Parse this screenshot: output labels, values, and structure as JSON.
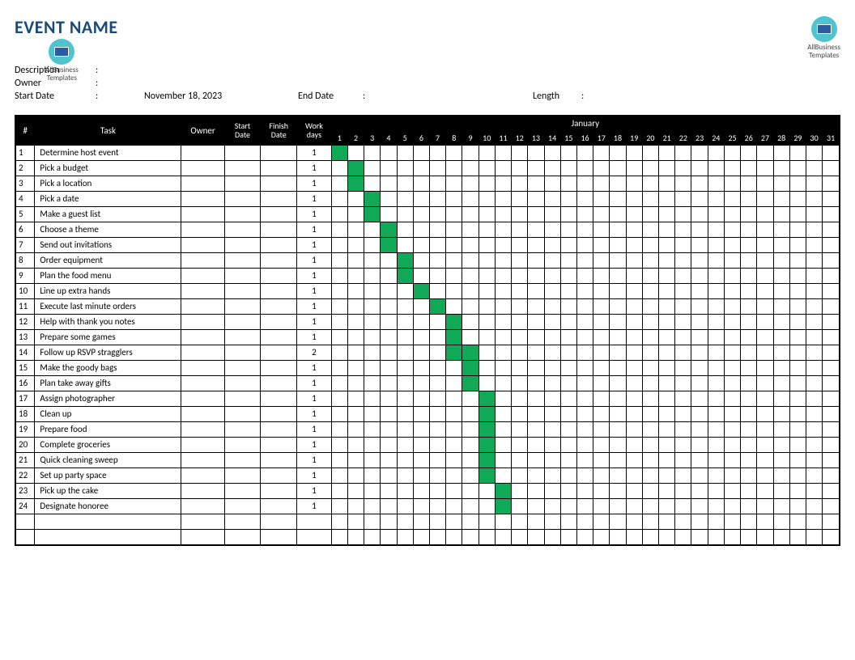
{
  "title": "EVENT NAME",
  "logo_text": "AllBusiness\nTemplates",
  "meta": {
    "description_label": "Description",
    "description_value": "",
    "owner_label": "Owner",
    "owner_value": "",
    "start_label": "Start Date",
    "start_value": "November 18, 2023",
    "end_label": "End Date",
    "end_value": "",
    "length_label": "Length",
    "length_value": ""
  },
  "columns": {
    "num": "#",
    "task": "Task",
    "owner": "Owner",
    "start": "Start Date",
    "finish": "Finish Date",
    "work": "Work days",
    "month": "January"
  },
  "days": [
    1,
    2,
    3,
    4,
    5,
    6,
    7,
    8,
    9,
    10,
    11,
    12,
    13,
    14,
    15,
    16,
    17,
    18,
    19,
    20,
    21,
    22,
    23,
    24,
    25,
    26,
    27,
    28,
    29,
    30,
    31
  ],
  "tasks": [
    {
      "num": 1,
      "name": "Determine host event",
      "owner": "",
      "start": "",
      "finish": "",
      "wd": 1,
      "bar_start": 1,
      "bar_len": 1
    },
    {
      "num": 2,
      "name": "Pick a budget",
      "owner": "",
      "start": "",
      "finish": "",
      "wd": 1,
      "bar_start": 2,
      "bar_len": 1
    },
    {
      "num": 3,
      "name": "Pick a location",
      "owner": "",
      "start": "",
      "finish": "",
      "wd": 1,
      "bar_start": 2,
      "bar_len": 1
    },
    {
      "num": 4,
      "name": "Pick a date",
      "owner": "",
      "start": "",
      "finish": "",
      "wd": 1,
      "bar_start": 3,
      "bar_len": 1
    },
    {
      "num": 5,
      "name": "Make a guest list",
      "owner": "",
      "start": "",
      "finish": "",
      "wd": 1,
      "bar_start": 3,
      "bar_len": 1
    },
    {
      "num": 6,
      "name": "Choose a theme",
      "owner": "",
      "start": "",
      "finish": "",
      "wd": 1,
      "bar_start": 4,
      "bar_len": 1
    },
    {
      "num": 7,
      "name": "Send out invitations",
      "owner": "",
      "start": "",
      "finish": "",
      "wd": 1,
      "bar_start": 4,
      "bar_len": 1
    },
    {
      "num": 8,
      "name": "Order equipment",
      "owner": "",
      "start": "",
      "finish": "",
      "wd": 1,
      "bar_start": 5,
      "bar_len": 1
    },
    {
      "num": 9,
      "name": "Plan the food menu",
      "owner": "",
      "start": "",
      "finish": "",
      "wd": 1,
      "bar_start": 5,
      "bar_len": 1
    },
    {
      "num": 10,
      "name": "Line up extra hands",
      "owner": "",
      "start": "",
      "finish": "",
      "wd": 1,
      "bar_start": 6,
      "bar_len": 1
    },
    {
      "num": 11,
      "name": "Execute last minute orders",
      "owner": "",
      "start": "",
      "finish": "",
      "wd": 1,
      "bar_start": 7,
      "bar_len": 1
    },
    {
      "num": 12,
      "name": "Help with thank you notes",
      "owner": "",
      "start": "",
      "finish": "",
      "wd": 1,
      "bar_start": 8,
      "bar_len": 1
    },
    {
      "num": 13,
      "name": "Prepare some games",
      "owner": "",
      "start": "",
      "finish": "",
      "wd": 1,
      "bar_start": 8,
      "bar_len": 1
    },
    {
      "num": 14,
      "name": "Follow up RSVP stragglers",
      "owner": "",
      "start": "",
      "finish": "",
      "wd": 2,
      "bar_start": 8,
      "bar_len": 2
    },
    {
      "num": 15,
      "name": "Make the goody bags",
      "owner": "",
      "start": "",
      "finish": "",
      "wd": 1,
      "bar_start": 9,
      "bar_len": 1
    },
    {
      "num": 16,
      "name": "Plan take away gifts",
      "owner": "",
      "start": "",
      "finish": "",
      "wd": 1,
      "bar_start": 9,
      "bar_len": 1
    },
    {
      "num": 17,
      "name": "Assign photographer",
      "owner": "",
      "start": "",
      "finish": "",
      "wd": 1,
      "bar_start": 10,
      "bar_len": 1
    },
    {
      "num": 18,
      "name": "Clean up",
      "owner": "",
      "start": "",
      "finish": "",
      "wd": 1,
      "bar_start": 10,
      "bar_len": 1
    },
    {
      "num": 19,
      "name": "Prepare food",
      "owner": "",
      "start": "",
      "finish": "",
      "wd": 1,
      "bar_start": 10,
      "bar_len": 1
    },
    {
      "num": 20,
      "name": "Complete groceries",
      "owner": "",
      "start": "",
      "finish": "",
      "wd": 1,
      "bar_start": 10,
      "bar_len": 1
    },
    {
      "num": 21,
      "name": "Quick cleaning sweep",
      "owner": "",
      "start": "",
      "finish": "",
      "wd": 1,
      "bar_start": 10,
      "bar_len": 1
    },
    {
      "num": 22,
      "name": "Set up party space",
      "owner": "",
      "start": "",
      "finish": "",
      "wd": 1,
      "bar_start": 10,
      "bar_len": 1
    },
    {
      "num": 23,
      "name": "Pick up the cake",
      "owner": "",
      "start": "",
      "finish": "",
      "wd": 1,
      "bar_start": 11,
      "bar_len": 1
    },
    {
      "num": 24,
      "name": "Designate honoree",
      "owner": "",
      "start": "",
      "finish": "",
      "wd": 1,
      "bar_start": 11,
      "bar_len": 1
    }
  ],
  "empty_rows": 2,
  "colors": {
    "bar": "#0fa958",
    "header_bg": "#000000",
    "header_fg": "#ffffff",
    "title": "#1a4a7a"
  }
}
